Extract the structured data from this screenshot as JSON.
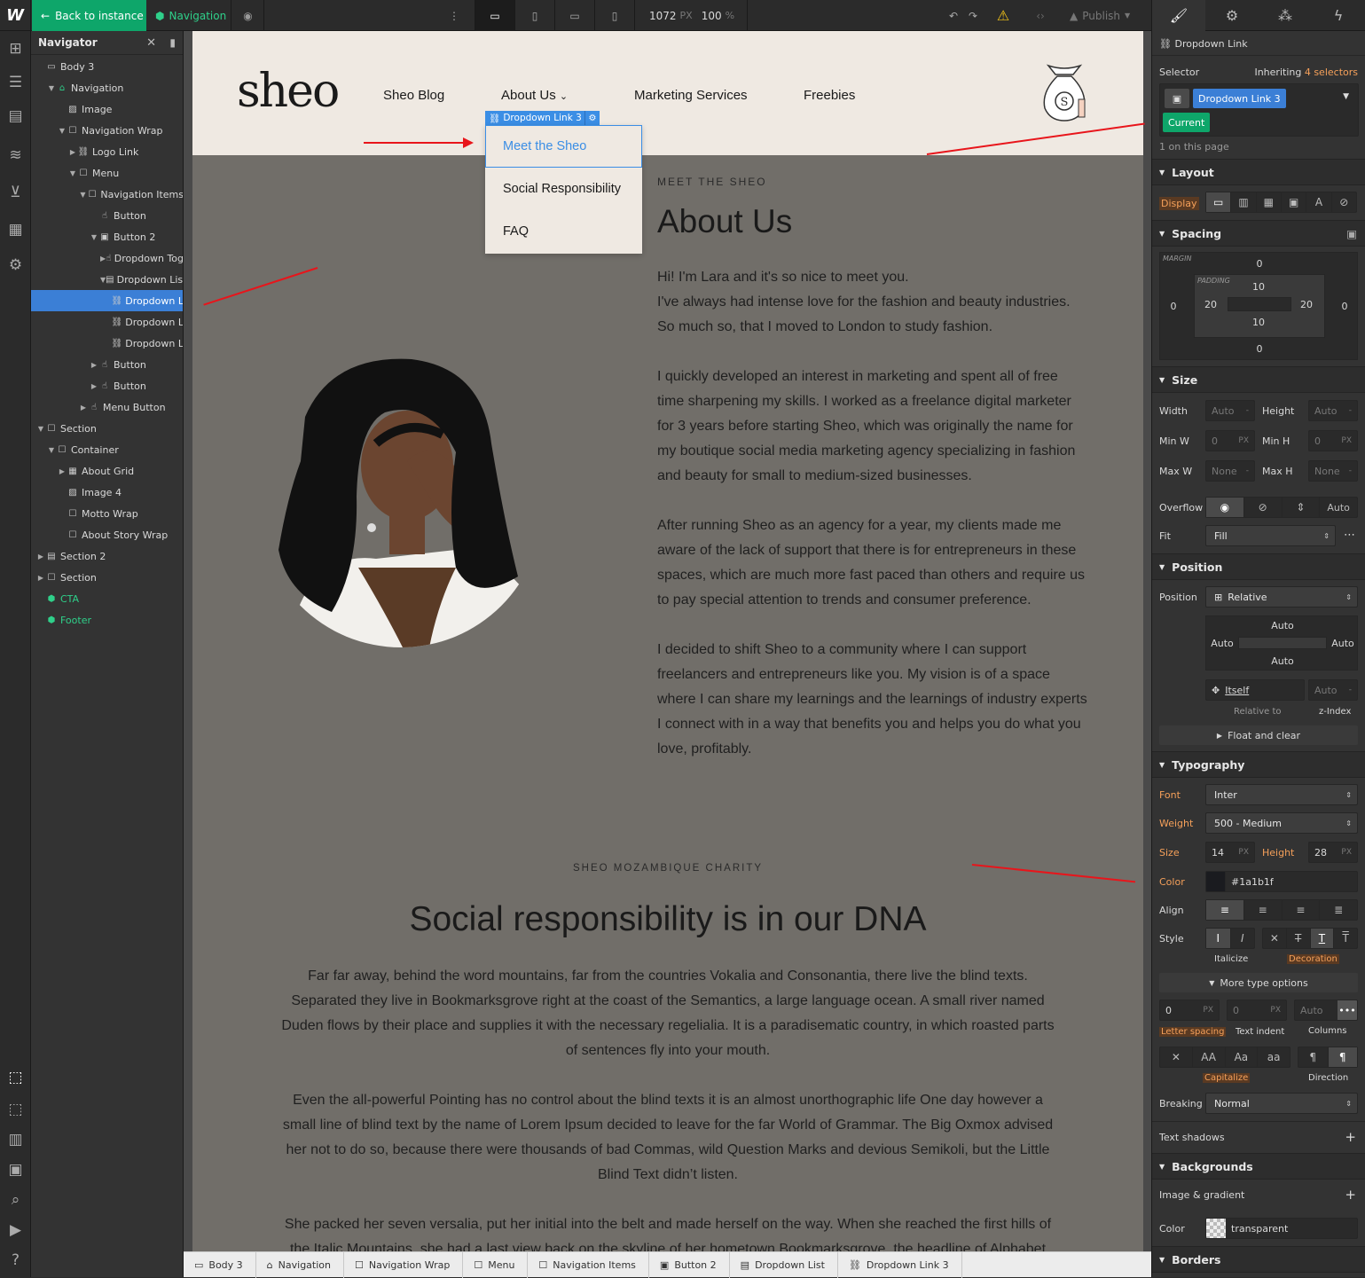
{
  "topbar": {
    "back_label": "Back to instance",
    "component_label": "Navigation",
    "width_value": "1072",
    "width_unit": "PX",
    "zoom_value": "100",
    "zoom_unit": "%",
    "publish_label": "Publish"
  },
  "navigator": {
    "title": "Navigator",
    "items": [
      {
        "label": "Body 3",
        "icon": "body-icon"
      },
      {
        "label": "Navigation",
        "icon": "home-icon"
      },
      {
        "label": "Image",
        "icon": "image-icon"
      },
      {
        "label": "Navigation Wrap",
        "icon": "box-icon"
      },
      {
        "label": "Logo Link",
        "icon": "link-icon"
      },
      {
        "label": "Menu",
        "icon": "box-icon"
      },
      {
        "label": "Navigation Items",
        "icon": "box-icon"
      },
      {
        "label": "Button",
        "icon": "hand-icon"
      },
      {
        "label": "Button 2",
        "icon": "dropdown-icon"
      },
      {
        "label": "Dropdown Tog",
        "icon": "hand-icon"
      },
      {
        "label": "Dropdown List",
        "icon": "list-icon"
      },
      {
        "label": "Dropdown L",
        "icon": "link-icon"
      },
      {
        "label": "Dropdown L",
        "icon": "link-icon"
      },
      {
        "label": "Dropdown L",
        "icon": "link-icon"
      },
      {
        "label": "Button",
        "icon": "hand-icon"
      },
      {
        "label": "Button",
        "icon": "hand-icon"
      },
      {
        "label": "Menu Button",
        "icon": "hand-icon"
      },
      {
        "label": "Section",
        "icon": "box-icon"
      },
      {
        "label": "Container",
        "icon": "box-icon"
      },
      {
        "label": "About Grid",
        "icon": "grid-icon"
      },
      {
        "label": "Image 4",
        "icon": "image-icon"
      },
      {
        "label": "Motto Wrap",
        "icon": "box-icon"
      },
      {
        "label": "About Story Wrap",
        "icon": "box-icon"
      },
      {
        "label": "Section 2",
        "icon": "section-icon"
      },
      {
        "label": "Section",
        "icon": "box-icon"
      },
      {
        "label": "CTA",
        "icon": "component-icon"
      },
      {
        "label": "Footer",
        "icon": "component-icon"
      }
    ]
  },
  "site": {
    "logo": "sheo",
    "menu": [
      "Sheo Blog",
      "About Us",
      "Marketing Services",
      "Freebies"
    ],
    "element_label": "Dropdown Link 3",
    "dropdown": [
      "Meet the Sheo",
      "Social Responsibility",
      "FAQ"
    ],
    "about": {
      "eyebrow": "MEET THE SHEO",
      "title": "About Us",
      "lines": [
        "Hi! I'm Lara and it's so nice to meet you.",
        "I've always had intense love for the fashion and beauty industries.",
        "So much so, that I moved to London to study fashion.",
        "I quickly developed an interest in marketing and spent all of free",
        "time sharpening my skills. I worked as a freelance digital marketer",
        "for 3 years before starting Sheo, which was originally the name for",
        "my boutique social media marketing agency specializing in fashion",
        "and beauty for small to medium-sized businesses.",
        "After running Sheo as an agency for a year, my clients made me",
        "aware of the lack of support that there is for entrepreneurs in these",
        "spaces, which are much more fast paced than others and require us",
        "to pay special attention to trends and consumer preference.",
        "I decided to shift Sheo to a community where I can support",
        "freelancers and entrepreneurs like you. My vision is of a space",
        "where I can share my learnings and the learnings of industry experts",
        "I connect with in a way that benefits you and helps you do what you",
        "love, profitably."
      ]
    },
    "charity": {
      "eyebrow": "SHEO MOZAMBIQUE CHARITY",
      "title": "Social responsibility is in our DNA",
      "lines": [
        "Far far away, behind the word mountains, far from the countries Vokalia and Consonantia, there live the blind texts.",
        "Separated they live in Bookmarksgrove right at the coast of the Semantics, a large language ocean. A small river named",
        "Duden flows by their place and supplies it with the necessary regelialia. It is a paradisematic country, in which roasted parts",
        "of sentences fly into your mouth.",
        "Even the all-powerful Pointing has no control about the blind texts it is an almost unorthographic life One day however a",
        "small line of blind text by the name of Lorem Ipsum decided to leave for the far World of Grammar. The Big Oxmox advised",
        "her not to do so, because there were thousands of bad Commas, wild Question Marks and devious Semikoli, but the Little",
        "Blind Text didn’t listen.",
        "She packed her seven versalia, put her initial into the belt and made herself on the way. When she reached the first hills of",
        "the Italic Mountains, she had a last view back on the skyline of her hometown Bookmarksgrove, the headline of Alphabet"
      ]
    }
  },
  "breadcrumbs": [
    "Body 3",
    "Navigation",
    "Navigation Wrap",
    "Menu",
    "Navigation Items",
    "Button 2",
    "Dropdown List",
    "Dropdown Link 3"
  ],
  "style_panel": {
    "element": "Dropdown Link",
    "selector_label": "Selector",
    "inheriting": "Inheriting",
    "inheriting_count": "4 selectors",
    "class_name": "Dropdown Link 3",
    "state": "Current",
    "page_count": "1 on this page",
    "layout": {
      "title": "Layout",
      "display_label": "Display"
    },
    "spacing": {
      "title": "Spacing",
      "margin_label": "MARGIN",
      "padding_label": "PADDING",
      "margin": {
        "top": "0",
        "right": "0",
        "bottom": "0",
        "left": "0"
      },
      "padding": {
        "top": "10",
        "right": "20",
        "bottom": "10",
        "left": "20"
      }
    },
    "size": {
      "title": "Size",
      "width_label": "Width",
      "width": "Auto",
      "height_label": "Height",
      "height": "Auto",
      "minw_label": "Min W",
      "minw": "0",
      "minh_label": "Min H",
      "minh": "0",
      "maxw_label": "Max W",
      "maxw": "None",
      "maxh_label": "Max H",
      "maxh": "None",
      "unit_px": "PX",
      "unit_dash": "-",
      "overflow_label": "Overflow",
      "overflow_auto": "Auto",
      "fit_label": "Fit",
      "fit": "Fill"
    },
    "position": {
      "title": "Position",
      "label": "Position",
      "value": "Relative",
      "top": "Auto",
      "left": "Auto",
      "right": "Auto",
      "bottom": "Auto",
      "relative_value": "Itself",
      "zindex": "Auto",
      "relative_label": "Relative to",
      "zindex_label": "z-Index",
      "float": "Float and clear"
    },
    "typography": {
      "title": "Typography",
      "font_label": "Font",
      "font": "Inter",
      "weight_label": "Weight",
      "weight": "500 - Medium",
      "size_label": "Size",
      "size": "14",
      "height_label": "Height",
      "height": "28",
      "color_label": "Color",
      "color": "#1a1b1f",
      "align_label": "Align",
      "style_label": "Style",
      "italicize": "Italicize",
      "decoration": "Decoration",
      "more": "More type options",
      "letter_spacing_value": "0",
      "text_indent_value": "0",
      "columns_value": "Auto",
      "letter_spacing": "Letter spacing",
      "text_indent": "Text indent",
      "columns": "Columns",
      "capitalize": "Capitalize",
      "direction": "Direction",
      "case_labels": [
        "AA",
        "Aa",
        "aa"
      ],
      "breaking_label": "Breaking",
      "breaking": "Normal",
      "shadows": "Text shadows"
    },
    "backgrounds": {
      "title": "Backgrounds",
      "image_label": "Image & gradient",
      "color_label": "Color",
      "color": "transparent"
    },
    "borders": {
      "title": "Borders"
    }
  },
  "colors": {
    "accent": "#3b8ee5",
    "green": "#0ea66a",
    "orange": "#f5a05a",
    "annotation": "#e8151b"
  }
}
